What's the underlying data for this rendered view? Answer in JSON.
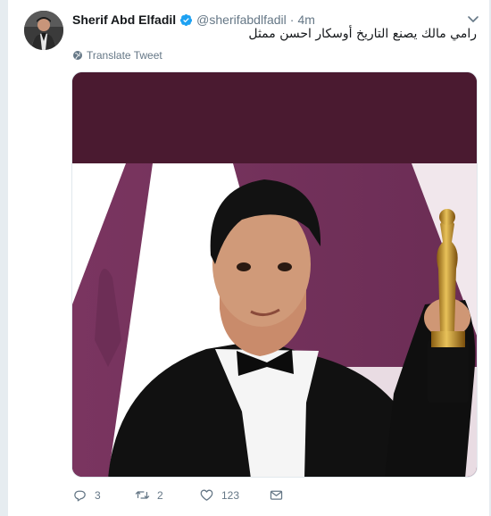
{
  "tweet": {
    "author_name": "Sherif Abd Elfadil",
    "handle": "@sherifabdlfadil",
    "separator": "·",
    "time": "4m",
    "text": "رامي مالك يصنع التاريخ أوسكار احسن ممثل",
    "translate_label": "Translate Tweet"
  },
  "actions": {
    "reply_count": "3",
    "retweet_count": "2",
    "like_count": "123"
  },
  "icons": {
    "verified": "verified-badge-icon",
    "caret": "chevron-down-icon",
    "globe": "globe-icon",
    "reply": "reply-icon",
    "retweet": "retweet-icon",
    "like": "heart-icon",
    "message": "envelope-icon"
  },
  "colors": {
    "accent": "#1da1f2",
    "secondary_text": "#657786",
    "photo_backdrop": "#6b2d52"
  }
}
